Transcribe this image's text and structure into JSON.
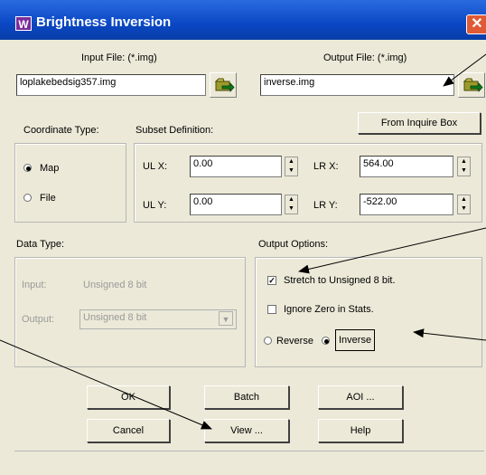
{
  "window": {
    "title": "Brightness Inversion",
    "close_glyph": "✕",
    "icon_glyph": "W"
  },
  "files": {
    "input_label": "Input File: (*.img)",
    "input_value": "loplakebedsig357.img",
    "output_label": "Output File: (*.img)",
    "output_value": "inverse.img"
  },
  "coordinate": {
    "label": "Coordinate Type:",
    "options": [
      "Map",
      "File"
    ],
    "selected": "Map"
  },
  "subset": {
    "label": "Subset Definition:",
    "inquire_button": "From Inquire Box",
    "ulx_label": "UL X:",
    "ulx_value": "0.00",
    "uly_label": "UL Y:",
    "uly_value": "0.00",
    "lrx_label": "LR X:",
    "lrx_value": "564.00",
    "lry_label": "LR Y:",
    "lry_value": "-522.00"
  },
  "data_type": {
    "label": "Data Type:",
    "input_label": "Input:",
    "input_value": "Unsigned 8 bit",
    "output_label": "Output:",
    "output_value": "Unsigned 8 bit"
  },
  "output_options": {
    "label": "Output Options:",
    "stretch_label": "Stretch to Unsigned 8 bit.",
    "stretch_checked": true,
    "ignore_zero_label": "Ignore Zero in Stats.",
    "ignore_zero_checked": false,
    "reverse_label": "Reverse",
    "inverse_label": "Inverse",
    "selected": "Inverse"
  },
  "buttons": {
    "ok": "OK",
    "batch": "Batch",
    "aoi": "AOI ...",
    "cancel": "Cancel",
    "view": "View ...",
    "help": "Help"
  },
  "icons": {
    "folder": "folder-open-icon",
    "spin": "spin-arrows-icon",
    "check_glyph": "✓"
  }
}
